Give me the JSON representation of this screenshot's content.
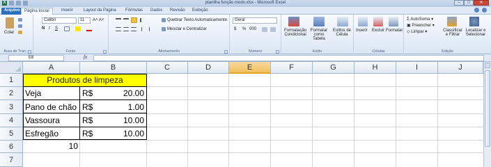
{
  "window": {
    "title": "planilha função modo.xlsx - Microsoft Excel",
    "logo_letter": "X"
  },
  "tabs": [
    "Arquivo",
    "Página Inicial",
    "Inserir",
    "Layout da Página",
    "Fórmulas",
    "Dados",
    "Revisão",
    "Exibição"
  ],
  "ribbon": {
    "clipboard": {
      "label": "Área de Tran...",
      "paste": "Colar"
    },
    "font": {
      "label": "Fonte",
      "name": "Calibri",
      "size": "11",
      "bold": "N",
      "italic": "I",
      "underline": "S"
    },
    "alignment": {
      "label": "Alinhamento",
      "wrap": "Quebrar Texto Automaticamente",
      "merge": "Mesclar e Centralizar"
    },
    "number": {
      "label": "Número",
      "format": "Geral",
      "currency": "$",
      "percent": "%",
      "thousands": "000"
    },
    "styles": {
      "label": "Estilo",
      "conditional": "Formatação Condicional",
      "as_table": "Formatar como Tabela",
      "cell_styles": "Estilos de Célula"
    },
    "cells": {
      "label": "Células",
      "insert": "Inserir",
      "delete": "Excluir",
      "format": "Formatar"
    },
    "editing": {
      "label": "Edição",
      "autosum": "AutoSoma",
      "fill": "Preencher",
      "clear": "Limpar",
      "sort": "Classificar e Filtrar",
      "find": "Localizar e Selecionar"
    }
  },
  "formula_bar": {
    "name_box": "E8",
    "fx": "fx",
    "value": ""
  },
  "columns": [
    "A",
    "B",
    "C",
    "D",
    "E",
    "F",
    "G",
    "H",
    "I",
    "J"
  ],
  "selected_column": "E",
  "rows": [
    "1",
    "2",
    "3",
    "4",
    "5",
    "6",
    "7"
  ],
  "sheet": {
    "title": "Produtos de limpeza",
    "items": [
      {
        "name": "Veja",
        "currency": "R$",
        "price": "20.00"
      },
      {
        "name": "Pano de chão",
        "currency": "R$",
        "price": "1.00"
      },
      {
        "name": "Vassoura",
        "currency": "R$",
        "price": "10.00"
      },
      {
        "name": "Esfregão",
        "currency": "R$",
        "price": "10.00"
      }
    ],
    "a6": "10"
  }
}
